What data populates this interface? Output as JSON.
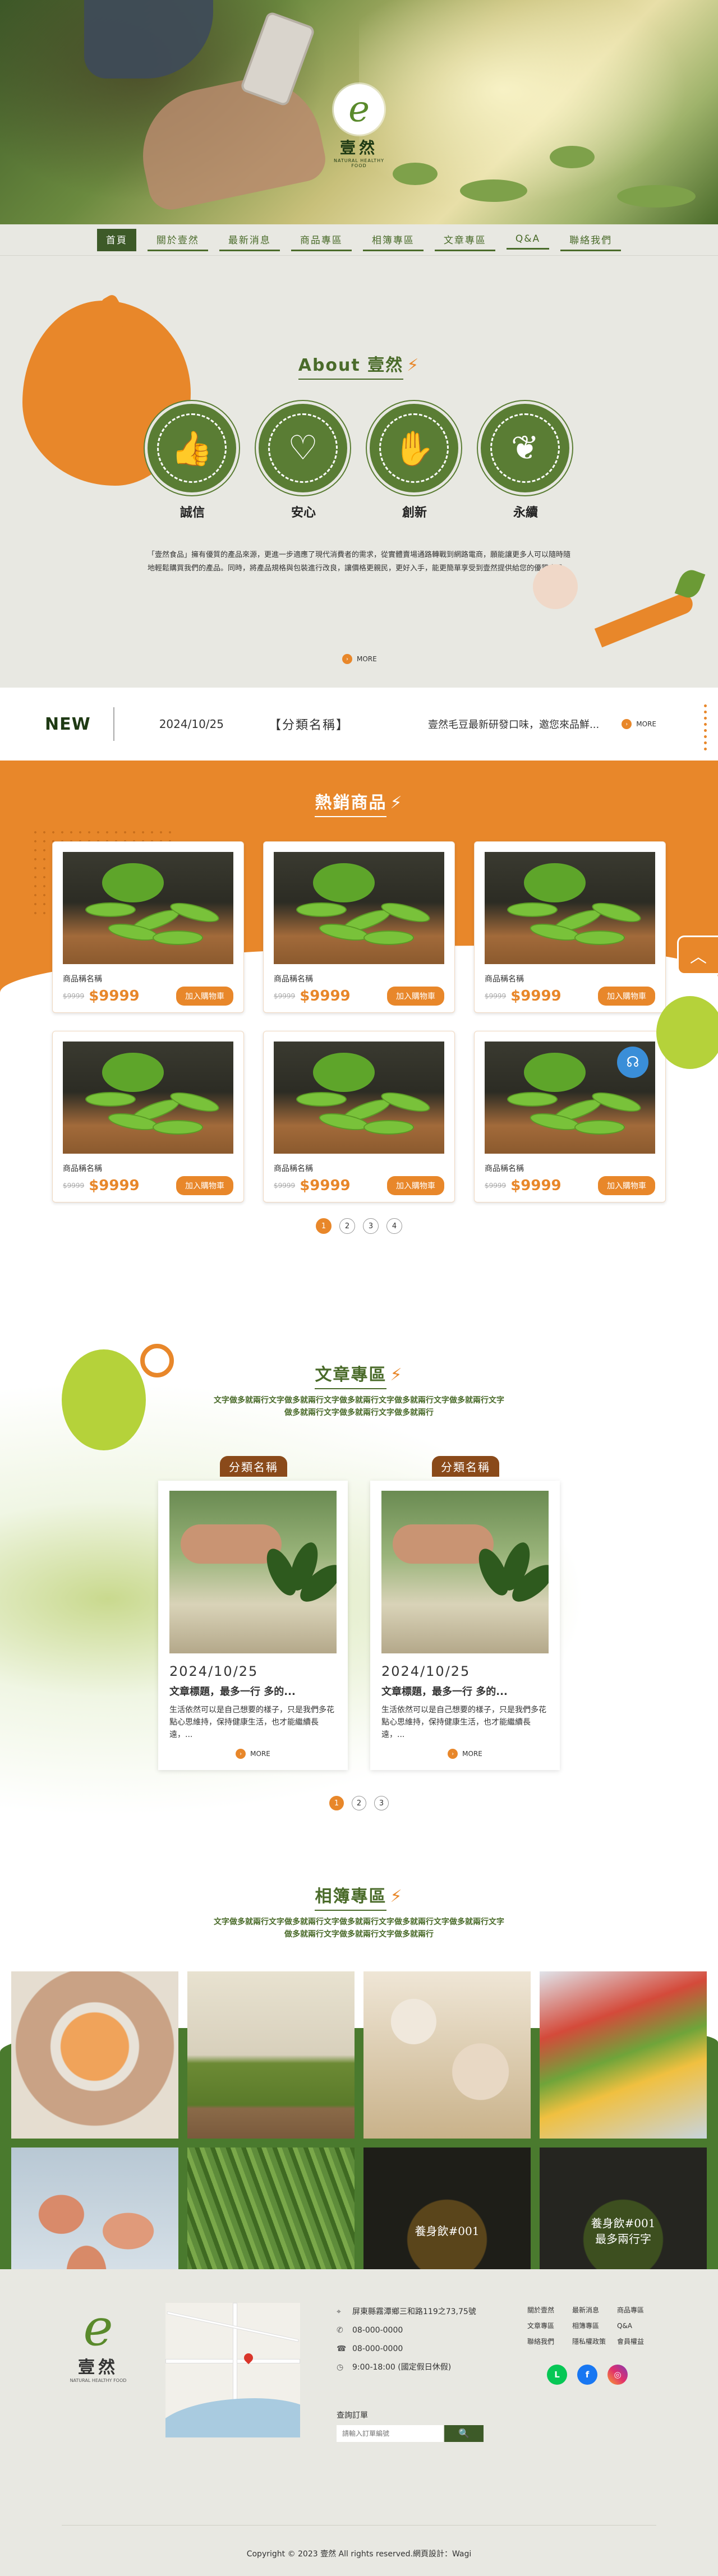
{
  "brand": {
    "name": "壹然",
    "tagline": "NATURAL HEALTHY FOOD"
  },
  "nav": [
    {
      "label": "首頁",
      "active": true
    },
    {
      "label": "關於壹然"
    },
    {
      "label": "最新消息"
    },
    {
      "label": "商品專區"
    },
    {
      "label": "相簿專區"
    },
    {
      "label": "文章專區"
    },
    {
      "label": "Q&A"
    },
    {
      "label": "聯絡我們"
    }
  ],
  "about": {
    "title": "About 壹然",
    "values": [
      {
        "label": "誠信",
        "icon": "thumbs-up-icon"
      },
      {
        "label": "安心",
        "icon": "heart-hands-icon"
      },
      {
        "label": "創新",
        "icon": "hand-idea-icon"
      },
      {
        "label": "永續",
        "icon": "leaf-icon"
      }
    ],
    "text": "「壹然食品」擁有優質的產品來源，更進一步適應了現代消費者的需求，從實體賣場通路轉戰到網路電商，願能讓更多人可以隨時隨地輕鬆購買我們的產品。同時，將產品規格與包裝進行改良，讓價格更親民，更好入手，能更簡單享受到壹然提供給您的優質食品。",
    "more": "MORE"
  },
  "news": {
    "label": "NEW",
    "date": "2024/10/25",
    "category": "【分類名稱】",
    "title": "壹然毛豆最新研發口味，邀您來品鮮...",
    "more": "MORE"
  },
  "hot": {
    "title": "熱銷商品",
    "products": [
      {
        "name": "商品稱名稱",
        "old": "$9999",
        "price": "$9999",
        "button": "加入購物車"
      },
      {
        "name": "商品稱名稱",
        "old": "$9999",
        "price": "$9999",
        "button": "加入購物車"
      },
      {
        "name": "商品稱名稱",
        "old": "$9999",
        "price": "$9999",
        "button": "加入購物車"
      },
      {
        "name": "商品稱名稱",
        "old": "$9999",
        "price": "$9999",
        "button": "加入購物車"
      },
      {
        "name": "商品稱名稱",
        "old": "$9999",
        "price": "$9999",
        "button": "加入購物車"
      },
      {
        "name": "商品稱名稱",
        "old": "$9999",
        "price": "$9999",
        "button": "加入購物車"
      }
    ],
    "pages": [
      "1",
      "2",
      "3",
      "4"
    ]
  },
  "articles": {
    "title": "文章專區",
    "subtitle1": "文字做多就兩行文字做多就兩行文字做多就兩行文字做多就兩行文字做多就兩行文字",
    "subtitle2": "做多就兩行文字做多就兩行文字做多就兩行",
    "items": [
      {
        "category": "分類名稱",
        "date": "2024/10/25",
        "title": "文章標題，最多一行 多的...",
        "desc": "生活依然可以是自己想要的樣子，只是我們多花點心思維持，保持健康生活，也才能繼續長遠，...",
        "more": "MORE"
      },
      {
        "category": "分類名稱",
        "date": "2024/10/25",
        "title": "文章標題，最多一行 多的...",
        "desc": "生活依然可以是自己想要的樣子，只是我們多花點心思維持，保持健康生活，也才能繼續長遠，...",
        "more": "MORE"
      }
    ],
    "pages": [
      "1",
      "2",
      "3"
    ]
  },
  "gallery": {
    "title": "相簿專區",
    "subtitle1": "文字做多就兩行文字做多就兩行文字做多就兩行文字做多就兩行文字做多就兩行文字",
    "subtitle2": "做多就兩行文字做多就兩行文字做多就兩行",
    "captions": [
      {
        "line1": "養身飲#001"
      },
      {
        "line1": "養身飲#001",
        "line2": "最多兩行字"
      }
    ]
  },
  "footer": {
    "address": "屏東縣霧潭鄉三和路119之73,75號",
    "phone1": "08-000-0000",
    "phone2": "08-000-0000",
    "hours": "9:00-18:00 (國定假日休假)",
    "order_title": "查詢訂單",
    "order_placeholder": "請輸入訂單編號",
    "order_button": "🔍",
    "links": [
      "關於壹然",
      "最新消息",
      "商品專區",
      "文章專區",
      "相簿專區",
      "Q&A",
      "聯絡我們",
      "隱私權政策",
      "會員權益"
    ],
    "copyright": "Copyright © 2023 壹然 All rights reserved.網頁設計：Wagi"
  },
  "colors": {
    "orange": "#e8872a",
    "green": "#4a6b2a",
    "darkgreen": "#3d5a28",
    "bg": "#e8e8e2"
  }
}
